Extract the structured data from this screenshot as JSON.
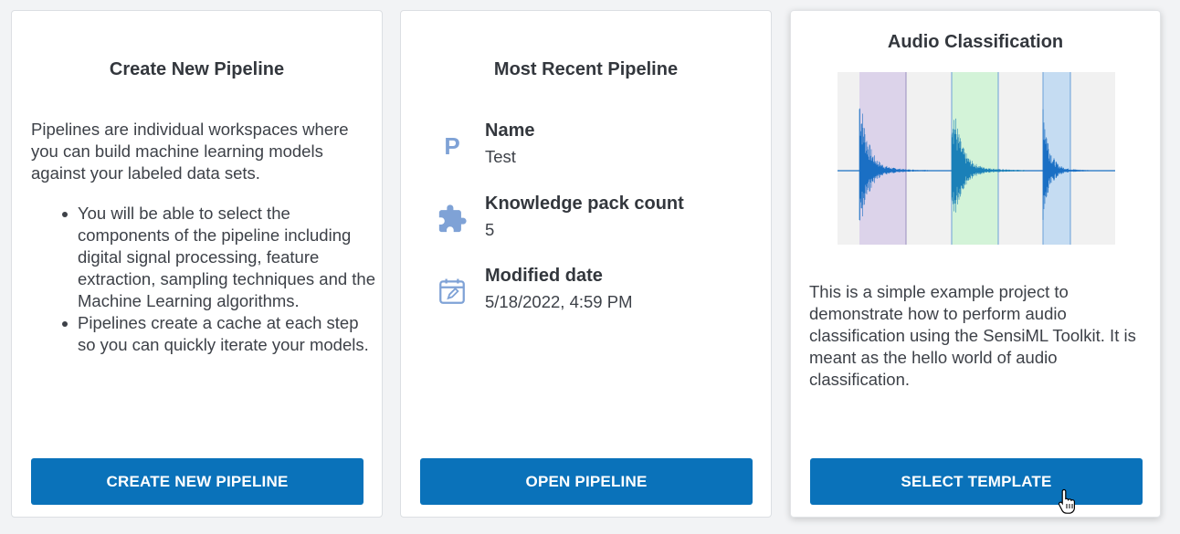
{
  "create_card": {
    "title": "Create New Pipeline",
    "description": "Pipelines are individual workspaces where you can build machine learning models against your labeled data sets.",
    "bullets": [
      "You will be able to select the components of the pipeline including digital signal processing, feature extraction, sampling techniques and the Machine Learning algorithms.",
      "Pipelines create a cache at each step so you can quickly iterate your models."
    ],
    "button_label": "CREATE NEW PIPELINE"
  },
  "recent_card": {
    "title": "Most Recent Pipeline",
    "name_label": "Name",
    "name_value": "Test",
    "name_icon_letter": "P",
    "kp_label": "Knowledge pack count",
    "kp_value": "5",
    "date_label": "Modified date",
    "date_value": "5/18/2022, 4:59 PM",
    "button_label": "OPEN PIPELINE"
  },
  "template_card": {
    "title": "Audio Classification",
    "description": "This is a simple example project to demonstrate how to perform audio classification using the SensiML Toolkit. It is meant as the hello world of audio classification.",
    "button_label": "SELECT TEMPLATE"
  },
  "icons": {
    "name_icon": "letter-p-icon",
    "kp_icon": "puzzle-piece-icon",
    "date_icon": "calendar-edit-icon",
    "cursor": "hand-pointer-icon"
  },
  "colors": {
    "primary_button": "#0a72ba",
    "icon_accent": "#7fa2d6",
    "wave_segment_1": "#dcd3ea",
    "wave_segment_2": "#d3f3d8",
    "wave_segment_3": "#c5dcf2",
    "waveform": "#1a6fc4"
  }
}
